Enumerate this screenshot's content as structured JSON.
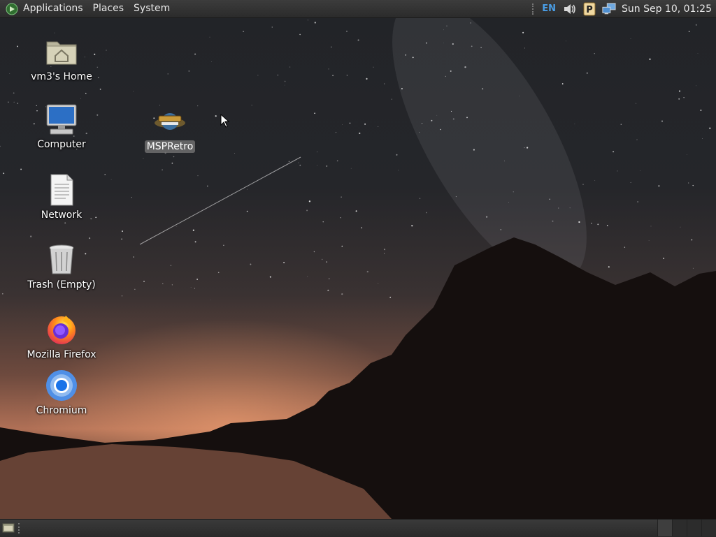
{
  "top_panel": {
    "menus": [
      "Applications",
      "Places",
      "System"
    ],
    "language": "EN",
    "clock": "Sun Sep 10, 01:25",
    "tray_icons": [
      "volume-icon",
      "clipboard-p-icon",
      "network-icon"
    ]
  },
  "desktop_icons": [
    {
      "name": "home-folder",
      "label": "vm3's Home",
      "icon": "home-folder-icon"
    },
    {
      "name": "computer",
      "label": "Computer",
      "icon": "computer-monitor-icon"
    },
    {
      "name": "network",
      "label": "Network",
      "icon": "document-icon"
    },
    {
      "name": "trash",
      "label": "Trash (Empty)",
      "icon": "trash-icon"
    },
    {
      "name": "mozilla-firefox",
      "label": "Mozilla Firefox",
      "icon": "firefox-icon"
    },
    {
      "name": "chromium",
      "label": "Chromium",
      "icon": "chromium-icon"
    },
    {
      "name": "mspretro",
      "label": "MSPRetro",
      "icon": "mspretro-icon",
      "selected": true
    }
  ],
  "bottom_panel": {
    "icons": [
      "show-desktop-icon"
    ],
    "workspaces": 4
  },
  "colors": {
    "panel": "#2e2e2e",
    "language": "#4a9ee6",
    "selection": "#787878"
  }
}
